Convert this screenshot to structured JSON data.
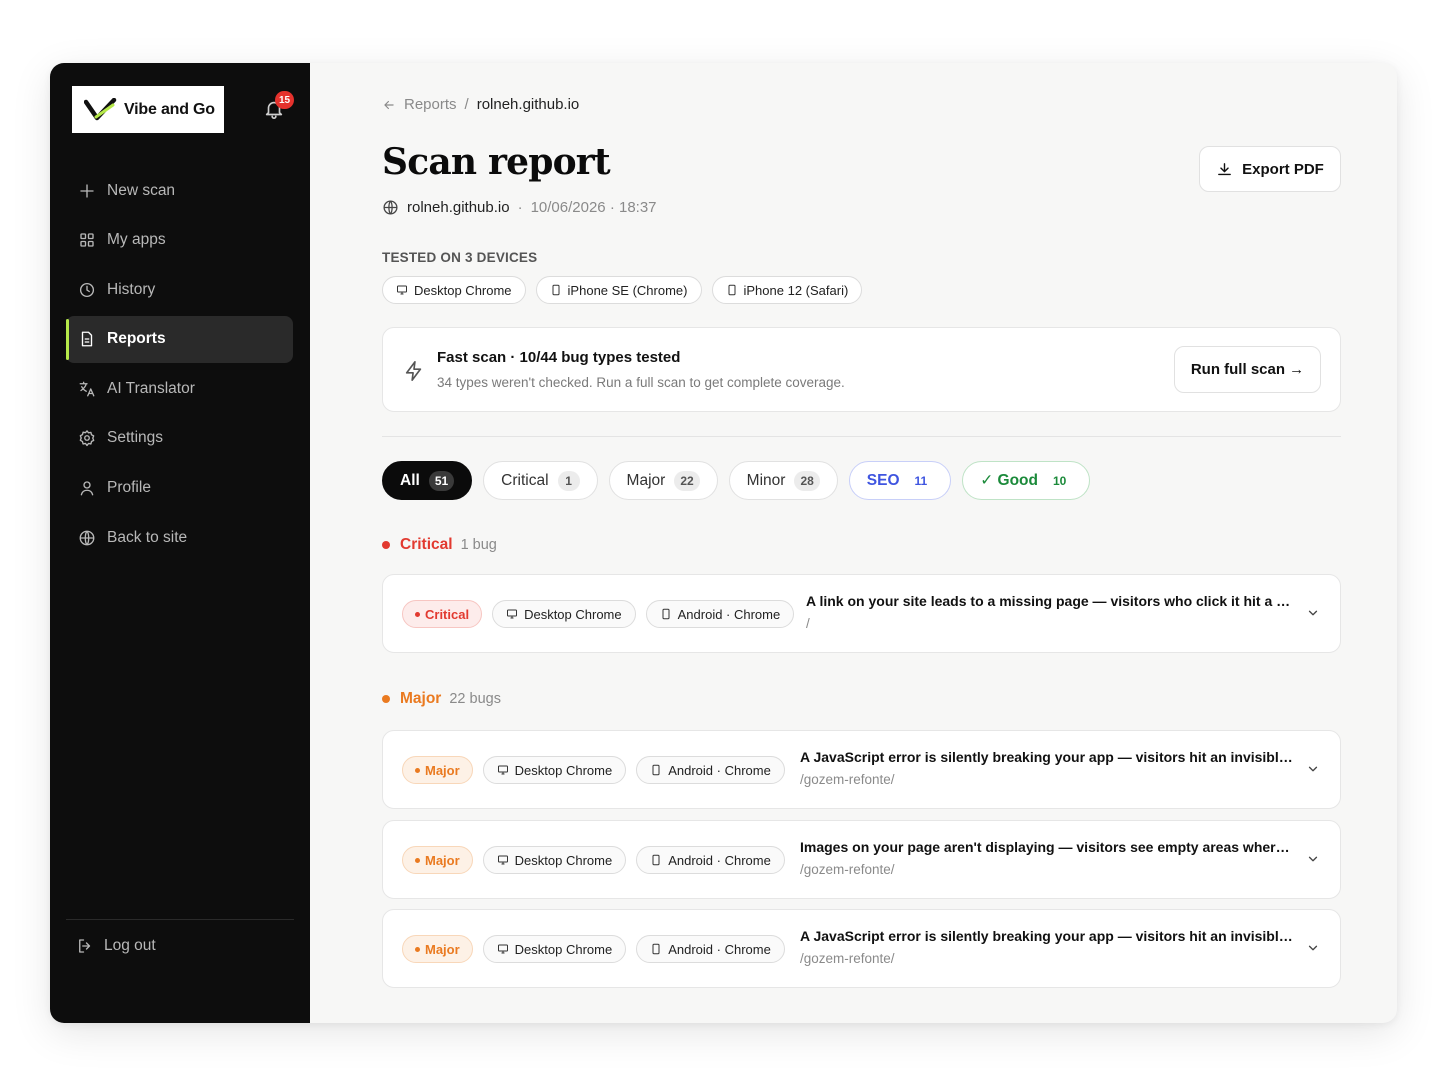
{
  "brand": {
    "name": "Vibe and Go",
    "notifications": "15"
  },
  "sidebar": {
    "items": [
      {
        "label": "New scan",
        "icon": "plus-icon"
      },
      {
        "label": "My apps",
        "icon": "grid-icon"
      },
      {
        "label": "History",
        "icon": "clock-icon"
      },
      {
        "label": "Reports",
        "icon": "document-icon",
        "active": true
      },
      {
        "label": "AI Translator",
        "icon": "translate-icon"
      },
      {
        "label": "Settings",
        "icon": "gear-icon"
      },
      {
        "label": "Profile",
        "icon": "user-icon"
      },
      {
        "label": "Back to site",
        "icon": "globe-icon"
      }
    ],
    "logout": "Log out"
  },
  "breadcrumb": {
    "parent": "Reports",
    "separator": "/",
    "current": "rolneh.github.io"
  },
  "page": {
    "title": "Scan report",
    "site": "rolneh.github.io",
    "dot": "·",
    "datetime": "10/06/2026 · 18:37",
    "export_label": "Export PDF"
  },
  "devices": {
    "label": "TESTED ON 3 DEVICES",
    "items": [
      "Desktop Chrome",
      "iPhone SE (Chrome)",
      "iPhone 12 (Safari)"
    ]
  },
  "notice": {
    "title": "Fast scan · 10/44 bug types tested",
    "subtitle": "34 types weren't checked. Run a full scan to get complete coverage.",
    "button": "Run full scan →"
  },
  "filters": [
    {
      "label": "All",
      "count": "51"
    },
    {
      "label": "Critical",
      "count": "1"
    },
    {
      "label": "Major",
      "count": "22"
    },
    {
      "label": "Minor",
      "count": "28"
    },
    {
      "label": "SEO",
      "count": "11"
    },
    {
      "label": "✓ Good",
      "count": "10"
    }
  ],
  "groups": {
    "critical": {
      "name": "Critical",
      "count": "1 bug",
      "color": "#e23a30"
    },
    "major": {
      "name": "Major",
      "count": "22 bugs",
      "color": "#ea7a20"
    }
  },
  "bugs": [
    {
      "severity": "Critical",
      "devices": [
        "Desktop Chrome",
        "Android · Chrome"
      ],
      "title": "A link on your site leads to a missing page — visitors who click it hit a dead...",
      "path": "/"
    },
    {
      "severity": "Major",
      "devices": [
        "Desktop Chrome",
        "Android · Chrome"
      ],
      "title": "A JavaScript error is silently breaking your app — visitors hit an invisible wal...",
      "path": "/gozem-refonte/"
    },
    {
      "severity": "Major",
      "devices": [
        "Desktop Chrome",
        "Android · Chrome"
      ],
      "title": "Images on your page aren't displaying — visitors see empty areas where co...",
      "path": "/gozem-refonte/"
    },
    {
      "severity": "Major",
      "devices": [
        "Desktop Chrome",
        "Android · Chrome"
      ],
      "title": "A JavaScript error is silently breaking your app — visitors hit an invisible wal...",
      "path": "/gozem-refonte/"
    }
  ]
}
